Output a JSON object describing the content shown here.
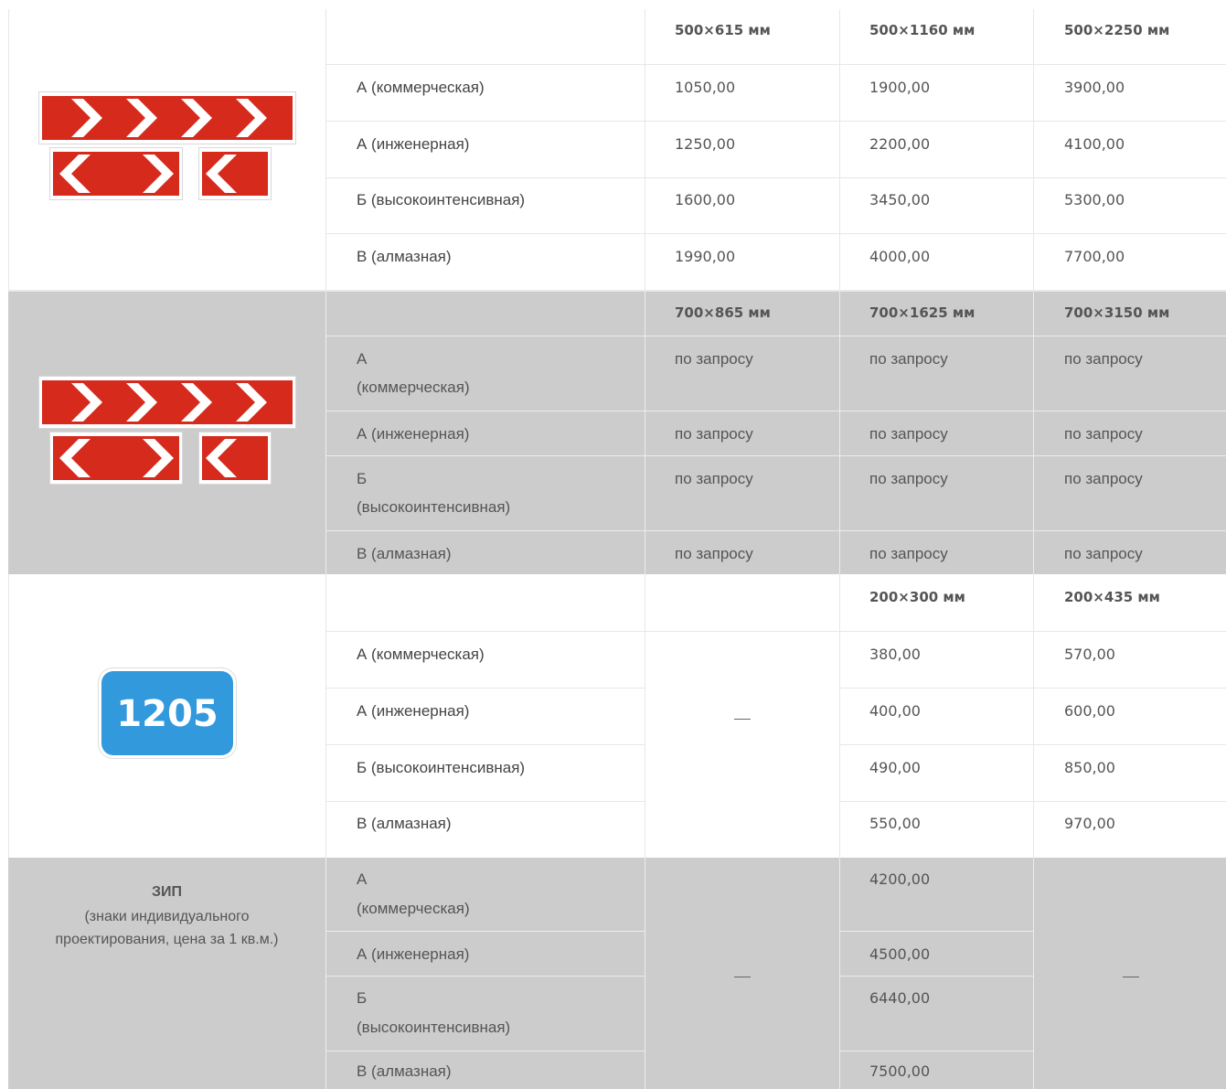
{
  "blocks": [
    {
      "sizes": [
        "500×615 мм",
        "500×1160 мм",
        "500×2250 мм"
      ],
      "rows": [
        {
          "label": "А (коммерческая)",
          "values": [
            "1050,00",
            "1900,00",
            "3900,00"
          ]
        },
        {
          "label": "А (инженерная)",
          "values": [
            "1250,00",
            "2200,00",
            "4100,00"
          ]
        },
        {
          "label": "Б (высокоинтенсивная)",
          "values": [
            "1600,00",
            "3450,00",
            "5300,00"
          ]
        },
        {
          "label": "В (алмазная)",
          "values": [
            "1990,00",
            "4000,00",
            "7700,00"
          ]
        }
      ]
    },
    {
      "sizes": [
        "700×865 мм",
        "700×1625 мм",
        "700×3150 мм"
      ],
      "rows": [
        {
          "label": [
            "А",
            "(коммерческая)"
          ],
          "values": [
            "по запросу",
            "по запросу",
            "по запросу"
          ]
        },
        {
          "label": "А (инженерная)",
          "values": [
            "по запросу",
            "по запросу",
            "по запросу"
          ]
        },
        {
          "label": [
            "Б",
            "(высокоинтенсивная)"
          ],
          "values": [
            "по запросу",
            "по запросу",
            "по запросу"
          ]
        },
        {
          "label": "В (алмазная)",
          "values": [
            "по запросу",
            "по запросу",
            "по запросу"
          ]
        }
      ]
    },
    {
      "sizes": [
        "200×300 мм",
        "200×435 мм"
      ],
      "dash": "—",
      "sign_number": "1205",
      "rows": [
        {
          "label": "А (коммерческая)",
          "values": [
            "380,00",
            "570,00"
          ]
        },
        {
          "label": "А (инженерная)",
          "values": [
            "400,00",
            "600,00"
          ]
        },
        {
          "label": "Б (высокоинтенсивная)",
          "values": [
            "490,00",
            "850,00"
          ]
        },
        {
          "label": "В (алмазная)",
          "values": [
            "550,00",
            "970,00"
          ]
        }
      ]
    },
    {
      "title": "ЗИП",
      "subtitle": "(знаки индивидуального проектирования, цена за 1 кв.м.)",
      "dash": "—",
      "rows": [
        {
          "label": [
            "А",
            "(коммерческая)"
          ],
          "values": [
            "4200,00"
          ]
        },
        {
          "label": "А (инженерная)",
          "values": [
            "4500,00"
          ]
        },
        {
          "label": [
            "Б",
            "(высокоинтенсивная)"
          ],
          "values": [
            "6440,00"
          ]
        },
        {
          "label": "В (алмазная)",
          "values": [
            "7500,00"
          ]
        }
      ]
    }
  ],
  "colors": {
    "sign_red": "#d52a1c",
    "sign_blue": "#3399dd",
    "zebra_gray": "#cccccc"
  },
  "icons": [
    "turn-direction-sign-icon",
    "turn-direction-sign-icon",
    "route-number-sign-icon"
  ]
}
